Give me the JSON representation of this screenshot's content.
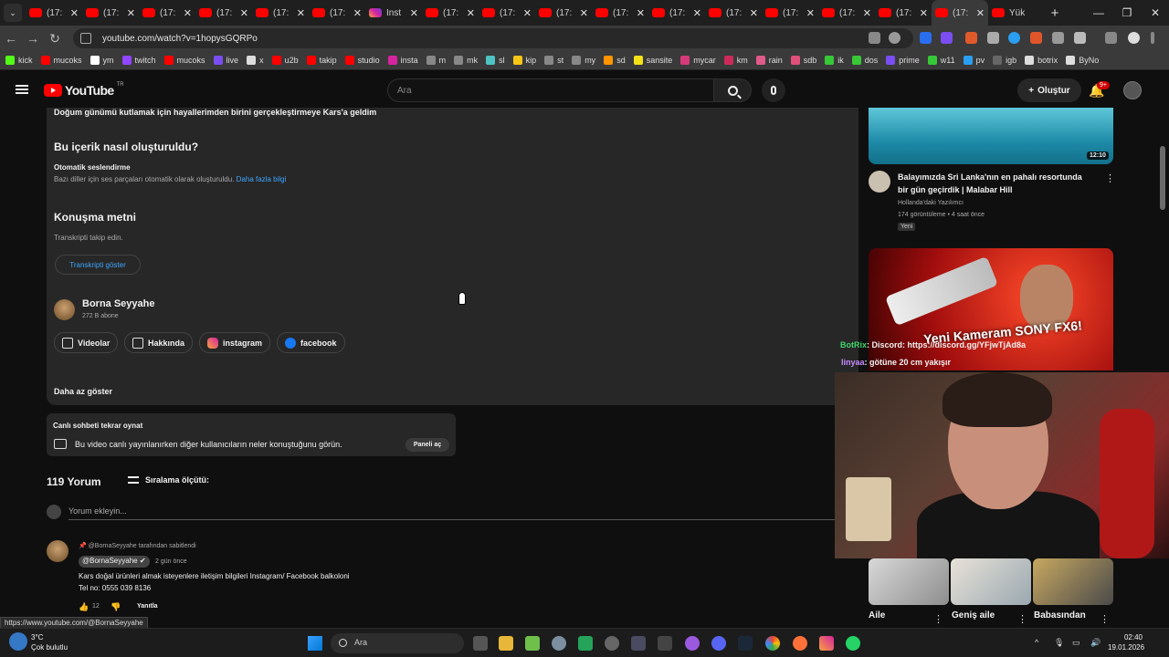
{
  "tabs": [
    {
      "label": "(17:",
      "icon": "youtube-icon"
    },
    {
      "label": "(17:",
      "icon": "youtube-icon"
    },
    {
      "label": "(17:",
      "icon": "youtube-icon"
    },
    {
      "label": "(17:",
      "icon": "youtube-icon"
    },
    {
      "label": "(17:",
      "icon": "youtube-icon"
    },
    {
      "label": "(17:",
      "icon": "youtube-icon"
    },
    {
      "label": "Inst",
      "icon": "instagram-icon"
    },
    {
      "label": "(17:",
      "icon": "youtube-icon"
    },
    {
      "label": "(17:",
      "icon": "youtube-icon"
    },
    {
      "label": "(17:",
      "icon": "youtube-icon"
    },
    {
      "label": "(17:",
      "icon": "youtube-icon"
    },
    {
      "label": "(17:",
      "icon": "youtube-icon"
    },
    {
      "label": "(17:",
      "icon": "youtube-icon"
    },
    {
      "label": "(17:",
      "icon": "youtube-icon"
    },
    {
      "label": "(17:",
      "icon": "youtube-icon"
    },
    {
      "label": "(17:",
      "icon": "youtube-icon"
    },
    {
      "label": "(17:",
      "icon": "youtube-icon"
    },
    {
      "label": "Yük",
      "icon": "loading-icon"
    }
  ],
  "url": "youtube.com/watch?v=1hopysGQRPo",
  "bookmarks": [
    "kick",
    "mucoks",
    "ym",
    "twitch",
    "mucoks",
    "live",
    "x",
    "u2b",
    "takip",
    "studio",
    "insta",
    "m",
    "mk",
    "sl",
    "kip",
    "st",
    "my",
    "sd",
    "sansite",
    "mycar",
    "km",
    "rain",
    "sdb",
    "ik",
    "dos",
    "prime",
    "w11",
    "pv",
    "igb",
    "botrix",
    "ByNo"
  ],
  "header": {
    "logo": "YouTube",
    "region": "TR",
    "search_placeholder": "Ara",
    "create_label": "Oluştur",
    "notif_count": "9+"
  },
  "description": {
    "top_text": "Doğum günümü kutlamak için hayallerimden birini gerçekleştirmeye Kars'a geldim",
    "how_title": "Bu içerik nasıl oluşturuldu?",
    "auto_dub": "Otomatik seslendirme",
    "auto_dub_desc": "Bazı diller için ses parçaları otomatik olarak oluşturuldu.",
    "learn_more": "Daha fazla bilgi",
    "transcript_title": "Konuşma metni",
    "transcript_desc": "Transkripti takip edin.",
    "transcript_button": "Transkripti göster",
    "channel_name": "Borna Seyyahe",
    "channel_subs": "272 B abone",
    "chips": [
      "Videolar",
      "Hakkında",
      "instagram",
      "facebook"
    ],
    "show_less": "Daha az göster"
  },
  "live_chat": {
    "title": "Canlı sohbeti tekrar oynat",
    "desc": "Bu video canlı yayınlanırken diğer kullanıcıların neler konuştuğunu görün.",
    "button": "Paneli aç"
  },
  "comments": {
    "count": "119 Yorum",
    "sort_label": "Sıralama ölçütü:",
    "add_placeholder": "Yorum ekleyin...",
    "pinned_by": "@BornaSeyyahe tarafından sabitlendi",
    "author": "@BornaSeyyahe",
    "time": "2 gün önce",
    "line1": "Kars doğal ürünleri almak isteyenlere iletişim bilgileri Instagram/ Facebook balkoloni",
    "line2": "Tel no: 0555 039 8136",
    "likes": "12",
    "reply": "Yanıtla"
  },
  "status_url": "https://www.youtube.com/@BornaSeyyahe",
  "sidebar": {
    "v1": {
      "duration": "12:10",
      "title": "Balayımızda Sri Lanka'nın en pahalı resortunda bir gün geçirdik | Malabar Hill",
      "channel": "Hollanda'daki Yazılımcı",
      "meta": "174 görüntüleme • 4 saat önce",
      "badge": "Yeni"
    },
    "v2": {
      "thumb_text": "Yeni Kameram SONY FX6!"
    },
    "row": [
      "Aile",
      "Geniş aile",
      "Babasından"
    ]
  },
  "overlay_chat": {
    "line1_user": "BotRix",
    "line1_text": ": Discord: https://discord.gg/YFjwTjAd8a",
    "line2_user": "linyaa",
    "line2_text": ": götüne 20 cm yakışır"
  },
  "taskbar": {
    "temp": "3°C",
    "condition": "Çok bulutlu",
    "search": "Ara",
    "time": "02:40",
    "date": "19.01.2026"
  }
}
